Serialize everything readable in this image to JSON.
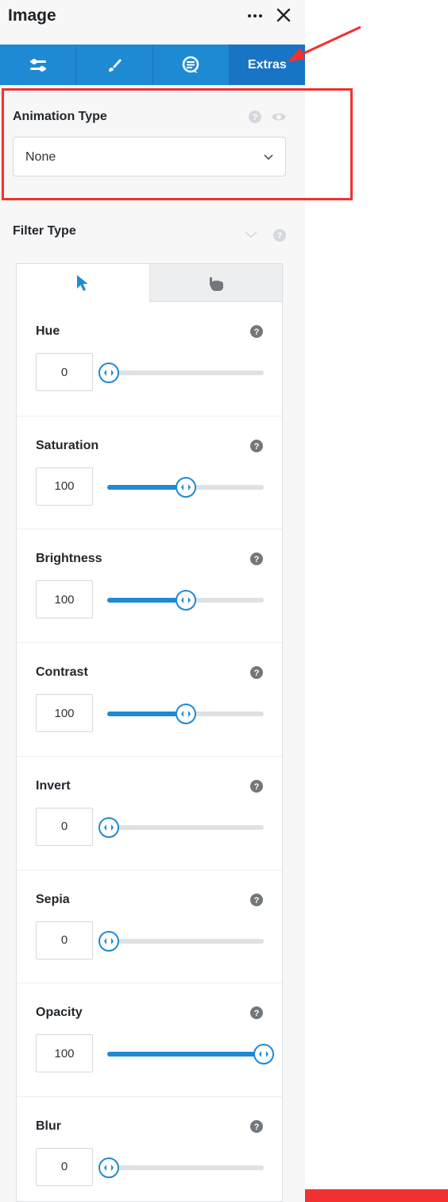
{
  "panel": {
    "title": "Image",
    "more_icon": "more-dots-icon",
    "close_icon": "close-icon"
  },
  "tabs": [
    {
      "name": "general",
      "icon": "sliders-icon",
      "label": ""
    },
    {
      "name": "style",
      "icon": "brush-icon",
      "label": ""
    },
    {
      "name": "advanced",
      "icon": "chat-bubble-icon",
      "label": ""
    },
    {
      "name": "extras",
      "icon": "",
      "label": "Extras",
      "active": true
    }
  ],
  "animation": {
    "label": "Animation Type",
    "value": "None"
  },
  "filter": {
    "label": "Filter Type",
    "state_tabs": [
      "normal-cursor-icon",
      "hover-hand-icon"
    ],
    "controls": [
      {
        "label": "Hue",
        "value": "0",
        "fill": 0
      },
      {
        "label": "Saturation",
        "value": "100",
        "fill": 0.5
      },
      {
        "label": "Brightness",
        "value": "100",
        "fill": 0.5
      },
      {
        "label": "Contrast",
        "value": "100",
        "fill": 0.5
      },
      {
        "label": "Invert",
        "value": "0",
        "fill": 0
      },
      {
        "label": "Sepia",
        "value": "0",
        "fill": 0
      },
      {
        "label": "Opacity",
        "value": "100",
        "fill": 1
      },
      {
        "label": "Blur",
        "value": "0",
        "fill": 0
      }
    ]
  },
  "colors": {
    "accent": "#1f8ad4",
    "highlight": "#f1312f"
  }
}
